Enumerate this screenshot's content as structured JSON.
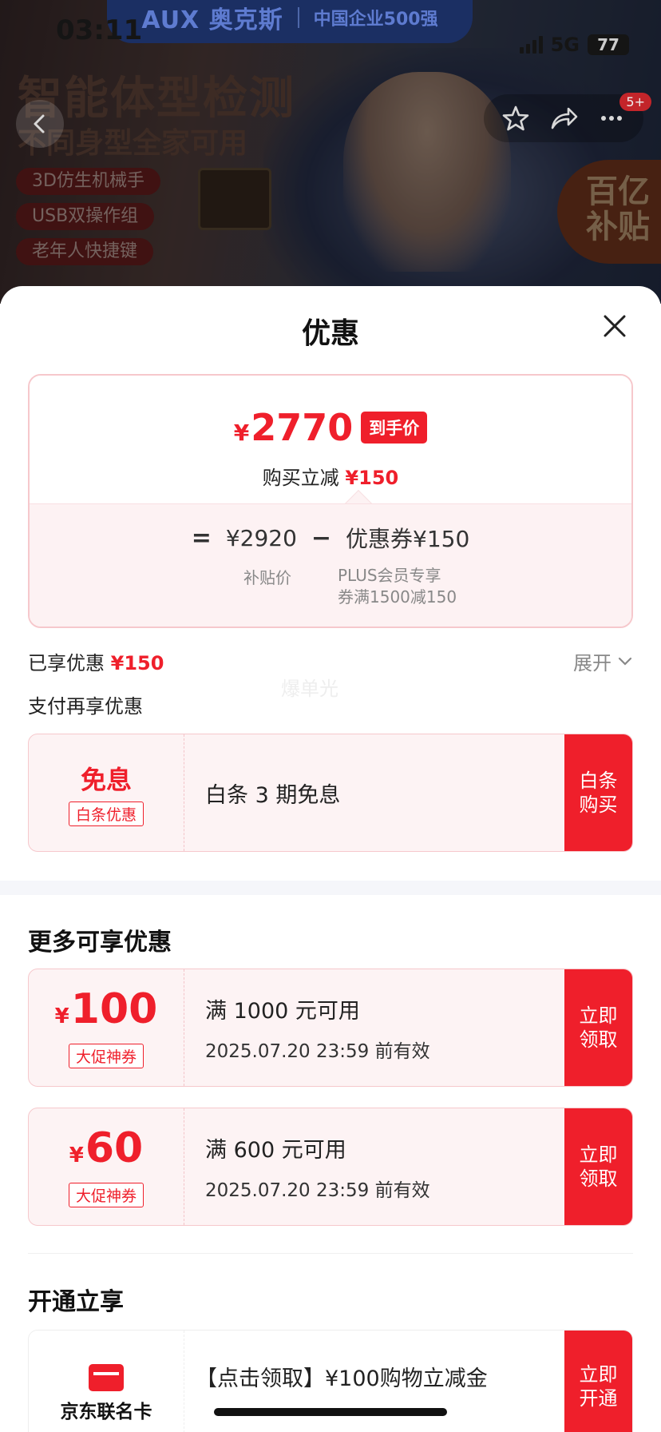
{
  "status_bar": {
    "time": "03:11",
    "network": "5G",
    "battery": "77"
  },
  "product_banner": {
    "brand_logo": "AUX 奥克斯",
    "brand_slogan": "中国企业500强",
    "headline": "智能体型检测",
    "subheadline": "不同身型全家可用",
    "tags": [
      "3D仿生机械手",
      "USB双操作组",
      "老年人快捷键"
    ],
    "subsidy_badge": [
      "百亿",
      "补贴"
    ],
    "nav_badge": "5+"
  },
  "icons": [
    "back-icon",
    "star-icon",
    "share-icon",
    "more-icon",
    "close-icon",
    "chevron-down-icon",
    "card-icon"
  ],
  "sheet": {
    "title": "优惠",
    "price_card": {
      "final_price": "2770",
      "currency": "¥",
      "final_tag": "到手价",
      "reduce_label": "购买立减",
      "reduce_amount": "¥150",
      "formula": {
        "equals": "=",
        "base": "¥2920",
        "minus": "−",
        "discount": "优惠券¥150",
        "base_caption": "补贴价",
        "discount_caption_1": "PLUS会员专享",
        "discount_caption_2": "券满1500减150"
      }
    },
    "enjoyed": {
      "label": "已享优惠",
      "amount": "¥150"
    },
    "expand_label": "展开",
    "watermark": "爆单光",
    "pay_more_label": "支付再享优惠",
    "baitiao": {
      "big": "免息",
      "label": "白条优惠",
      "text": "白条 3 期免息",
      "button": "白条购买"
    },
    "more_section": {
      "title": "更多可享优惠",
      "coupons": [
        {
          "currency": "¥",
          "amount": "100",
          "label": "大促神券",
          "condition": "满 1000 元可用",
          "valid": "2025.07.20 23:59 前有效",
          "button": "立即领取"
        },
        {
          "currency": "¥",
          "amount": "60",
          "label": "大促神券",
          "condition": "满 600 元可用",
          "valid": "2025.07.20 23:59 前有效",
          "button": "立即领取"
        }
      ]
    },
    "open_section": {
      "title": "开通立享",
      "card_name": "京东联名卡",
      "text": "【点击领取】¥100购物立减金",
      "button": "立即开通"
    }
  },
  "colors": {
    "accent_red": "#ef1f2b",
    "coupon_bg": "#fdf3f4",
    "border_pink": "#f6c8cc"
  }
}
